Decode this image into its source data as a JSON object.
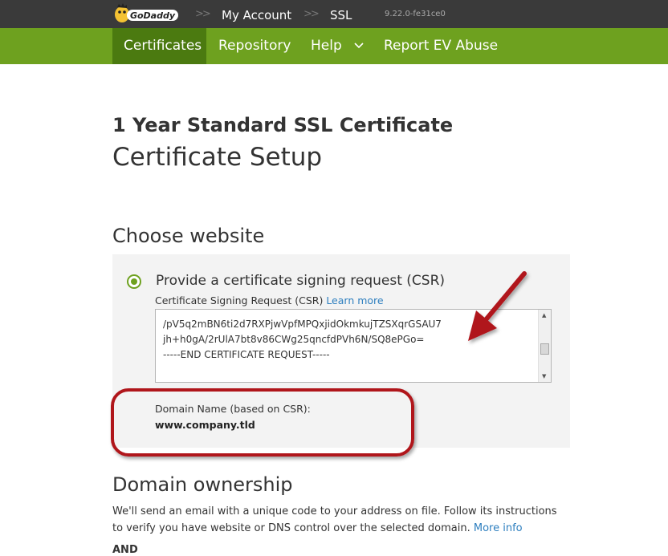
{
  "topbar": {
    "logo_text": "GoDaddy",
    "breadcrumbs": [
      {
        "label": "My Account"
      },
      {
        "label": "SSL"
      }
    ],
    "separator": ">>",
    "version": "9.22.0-fe31ce0"
  },
  "nav": {
    "items": [
      {
        "label": "Certificates",
        "active": true
      },
      {
        "label": "Repository"
      },
      {
        "label": "Help",
        "has_dropdown": true
      },
      {
        "label": "Report EV Abuse"
      }
    ],
    "chevron": "⌵"
  },
  "page": {
    "product_title": "1 Year Standard SSL Certificate",
    "setup_title": "Certificate Setup"
  },
  "choose_website": {
    "heading": "Choose website",
    "option_label": "Provide a certificate signing request (CSR)",
    "selected": true,
    "csr_field_label": "Certificate Signing Request (CSR)",
    "learn_more": "Learn more",
    "csr_lines": [
      "/pV5q2mBN6ti2d7RXPjwVpfMPQxjidOkmkujTZSXqrGSAU7",
      "jh+h0gA/2rUlA7bt8v86CWg25qncfdPVh6N/SQ8ePGo=",
      "-----END CERTIFICATE REQUEST-----"
    ],
    "domain_label": "Domain Name (based on CSR):",
    "domain_value": "www.company.tld"
  },
  "domain_ownership": {
    "heading": "Domain ownership",
    "description": "We'll send an email with a unique code to your address on file. Follow its instructions to verify you have website or DNS control over the selected domain.",
    "more_info": "More info",
    "and_label": "AND"
  },
  "colors": {
    "topbar": "#3a3a3a",
    "nav_green": "#6ea11f",
    "nav_active": "#4b7a10",
    "link": "#2e7fbf",
    "annotation_red": "#b0161b"
  },
  "icons": {
    "radio": "radio-selected-icon",
    "scroll_up": "scroll-up-icon",
    "scroll_down": "scroll-down-icon",
    "chevron": "chevron-down-icon"
  }
}
